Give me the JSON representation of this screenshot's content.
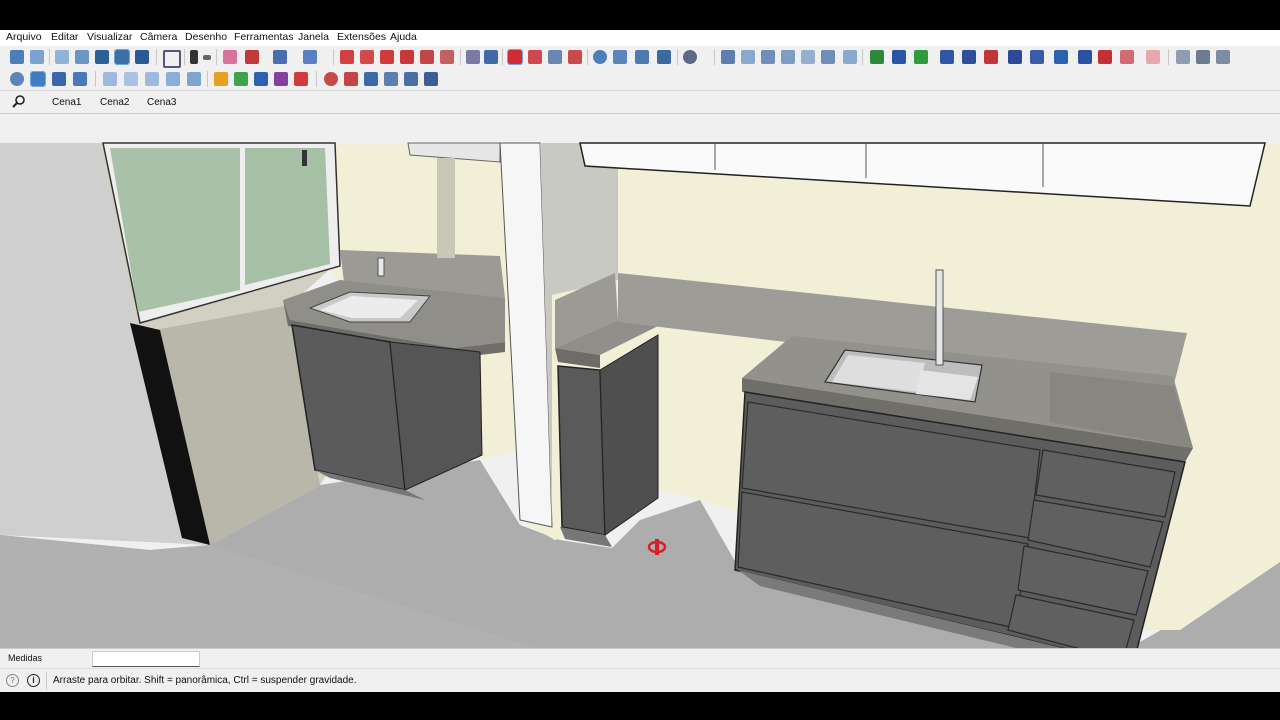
{
  "menu": {
    "items": [
      "Arquivo",
      "Editar",
      "Visualizar",
      "Câmera",
      "Desenho",
      "Ferramentas",
      "Janela",
      "Extensões",
      "Ajuda"
    ]
  },
  "toolbar_icons": {
    "row1": [
      "iso-view-icon",
      "top-view-icon",
      "front-view-icon",
      "right-view-icon",
      "back-view-icon",
      "left-view-icon",
      "zoom-icon",
      "select-icon",
      "eraser-icon",
      "pencil-icon",
      "line-icon",
      "rectangle-icon",
      "push-pull-icon",
      "move-icon",
      "rotate-icon",
      "scale-icon",
      "offset-icon",
      "tape-icon",
      "protractor-icon",
      "orbit-icon",
      "pan-icon",
      "zoom-window-icon",
      "zoom-extents-icon",
      "section-icon",
      "layers-icon",
      "styles-icon",
      "components-icon",
      "materials-icon",
      "geo-icon"
    ],
    "row2": [
      "walk-icon",
      "look-around-icon",
      "position-camera-icon",
      "xray-icon",
      "shaded-icon",
      "textured-icon",
      "monochrome-icon",
      "sandbox-icon",
      "warehouse-icon",
      "extension-icon",
      "dimension-icon",
      "text-icon",
      "axes-icon",
      "3d-text-icon"
    ]
  },
  "scenes": {
    "tabs": [
      "Cena1",
      "Cena2",
      "Cena3"
    ]
  },
  "measures": {
    "label": "Medidas",
    "value": ""
  },
  "status": {
    "message": "Arraste para orbitar. Shift = panorâmica, Ctrl = suspender gravidade."
  },
  "colors": {
    "wall": "#f1eed8",
    "floor": "#a9a9a9",
    "countertop": "#8f8e8a",
    "cabinet": "#5b5b5b",
    "orbit_cursor": "#d81e2b"
  }
}
